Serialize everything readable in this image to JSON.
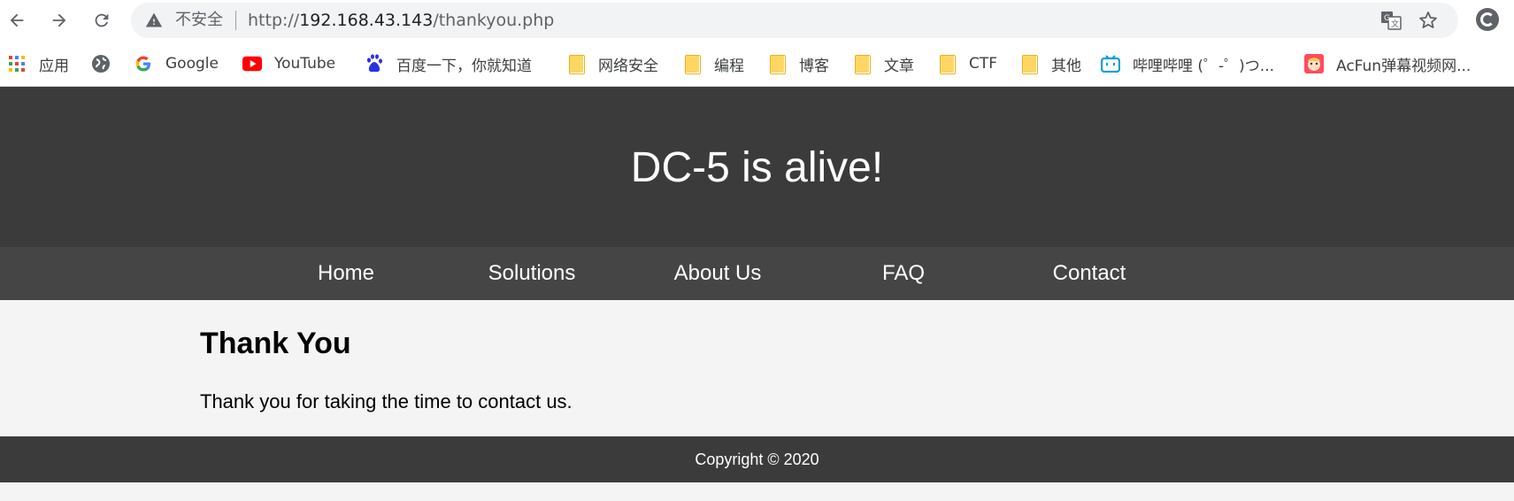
{
  "browser": {
    "security_label": "不安全",
    "url_scheme": "http://",
    "url_host": "192.168.43.143",
    "url_path": "/thankyou.php",
    "icons": [
      "back-icon",
      "forward-icon",
      "reload-icon",
      "warning-icon",
      "translate-icon",
      "star-icon",
      "profile-icon"
    ]
  },
  "bookmarks": [
    {
      "label": "应用",
      "icon": "apps-grid-icon"
    },
    {
      "label": "",
      "icon": "globe-icon"
    },
    {
      "label": "Google",
      "icon": "google-icon"
    },
    {
      "label": "YouTube",
      "icon": "youtube-icon"
    },
    {
      "label": "百度一下，你就知道",
      "icon": "baidu-icon"
    },
    {
      "label": "网络安全",
      "icon": "folder-icon"
    },
    {
      "label": "编程",
      "icon": "folder-icon"
    },
    {
      "label": "博客",
      "icon": "folder-icon"
    },
    {
      "label": "文章",
      "icon": "folder-icon"
    },
    {
      "label": "CTF",
      "icon": "folder-icon"
    },
    {
      "label": "其他",
      "icon": "folder-icon"
    },
    {
      "label": "哔哩哔哩 (゜-゜)つ...",
      "icon": "bilibili-icon"
    },
    {
      "label": "AcFun弹幕视频网...",
      "icon": "acfun-icon"
    }
  ],
  "site": {
    "title": "DC-5 is alive!",
    "nav": [
      "Home",
      "Solutions",
      "About Us",
      "FAQ",
      "Contact"
    ],
    "heading": "Thank You",
    "message": "Thank you for taking the time to contact us.",
    "footer": "Copyright © 2020"
  },
  "colors": {
    "header_bg": "#3b3b3b",
    "nav_bg": "#454545",
    "content_bg": "#f4f4f4",
    "footer_bg": "#3b3b3b"
  }
}
